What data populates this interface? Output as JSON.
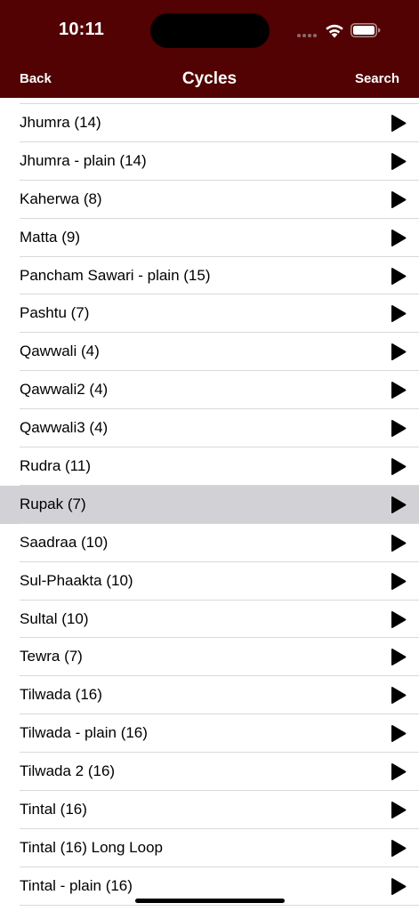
{
  "status_bar": {
    "time": "10:11"
  },
  "nav": {
    "back_label": "Back",
    "title": "Cycles",
    "search_label": "Search"
  },
  "colors": {
    "header_bg": "#520202",
    "selected_row_bg": "#d1d1d6"
  },
  "icons": {
    "row_action": "play-icon",
    "status": [
      "signal-icon",
      "wifi-icon",
      "battery-icon"
    ]
  },
  "cycles": [
    {
      "label": "Jhumra (14)"
    },
    {
      "label": "Jhumra - plain (14)"
    },
    {
      "label": "Kaherwa (8)"
    },
    {
      "label": "Matta (9)"
    },
    {
      "label": "Pancham Sawari - plain (15)"
    },
    {
      "label": "Pashtu (7)"
    },
    {
      "label": "Qawwali (4)"
    },
    {
      "label": "Qawwali2 (4)"
    },
    {
      "label": "Qawwali3 (4)"
    },
    {
      "label": "Rudra (11)"
    },
    {
      "label": "Rupak (7)",
      "selected": true
    },
    {
      "label": "Saadraa (10)"
    },
    {
      "label": "Sul-Phaakta (10)"
    },
    {
      "label": "Sultal (10)"
    },
    {
      "label": "Tewra (7)"
    },
    {
      "label": "Tilwada (16)"
    },
    {
      "label": "Tilwada - plain (16)"
    },
    {
      "label": "Tilwada 2 (16)"
    },
    {
      "label": "Tintal (16)"
    },
    {
      "label": "Tintal (16) Long Loop"
    },
    {
      "label": "Tintal - plain (16)"
    }
  ]
}
